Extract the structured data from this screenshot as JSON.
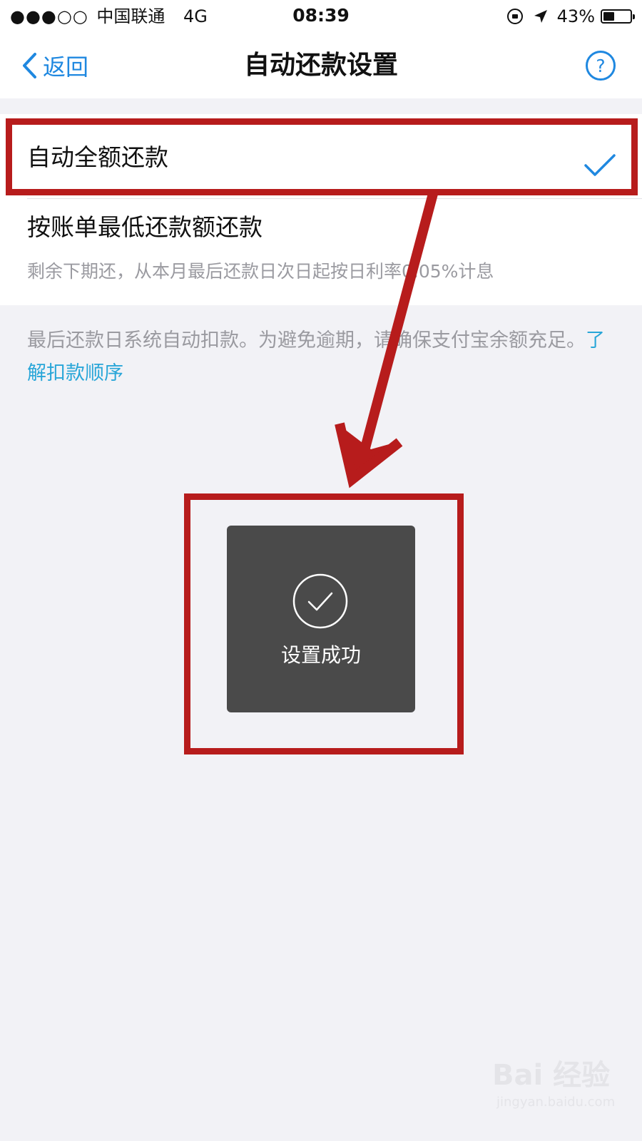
{
  "status_bar": {
    "signal": "●●●○○",
    "carrier": "中国联通",
    "network": "4G",
    "time": "08:39",
    "battery_percent_text": "43%",
    "battery_level": 0.43
  },
  "nav": {
    "back_label": "返回",
    "title": "自动还款设置",
    "help_icon": "question-circle-icon",
    "accent_color": "#1f88e0"
  },
  "options": [
    {
      "label": "自动全额还款",
      "selected": true
    },
    {
      "label": "按账单最低还款额还款",
      "description": "剩余下期还，从本月最后还款日次日起按日利率0.05%计息",
      "selected": false
    }
  ],
  "notice": {
    "text": "最后还款日系统自动扣款。为避免逾期，请确保支付宝余额充足。",
    "link_label": "了解扣款顺序",
    "link_color": "#29a6d8"
  },
  "toast": {
    "icon": "check-circle-icon",
    "message": "设置成功"
  },
  "annotation": {
    "color": "#b71c1c"
  },
  "watermark": {
    "logo": "Bai 经验",
    "url": "jingyan.baidu.com"
  }
}
